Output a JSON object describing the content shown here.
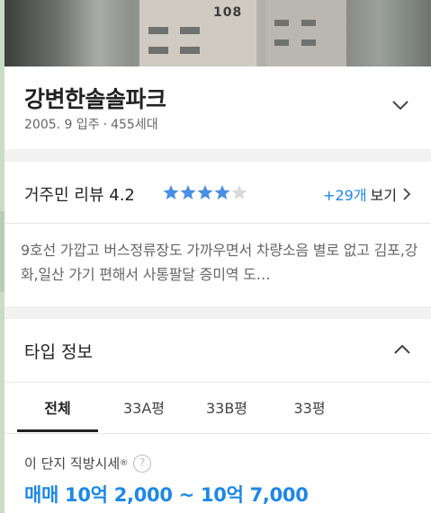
{
  "apartment": {
    "name": "강변한솔솔파크",
    "built": "2005. 9 입주",
    "separator": "·",
    "households": "455세대",
    "building_number": "108"
  },
  "review": {
    "label": "거주민 리뷰 4.2",
    "rating": 4.2,
    "max_rating": 5,
    "more_count": "+29개",
    "more_label": "보기",
    "text": "9호선 가깝고 버스정류장도 가까우면서 차량소음 별로 없고 김포,강화,일산 가기 편해서 사통팔달 증미역 도…"
  },
  "type_info": {
    "title": "타입 정보",
    "tabs": [
      {
        "label": "전체",
        "active": true
      },
      {
        "label": "33A평",
        "active": false
      },
      {
        "label": "33B평",
        "active": false
      },
      {
        "label": "33평",
        "active": false
      }
    ]
  },
  "price": {
    "label": "이 단지 직방시세",
    "registered_mark": "®",
    "help": "?",
    "range": "매매 10억 2,000 ~ 10억 7,000"
  },
  "colors": {
    "accent": "#1e88e5",
    "star_filled": "#4a90e2",
    "star_empty": "#d9d9d9"
  },
  "icons": {
    "collapse_header": "chevron-down-icon",
    "more": "chevron-right-icon",
    "collapse_types": "chevron-up-icon",
    "help": "question-circle-icon"
  }
}
